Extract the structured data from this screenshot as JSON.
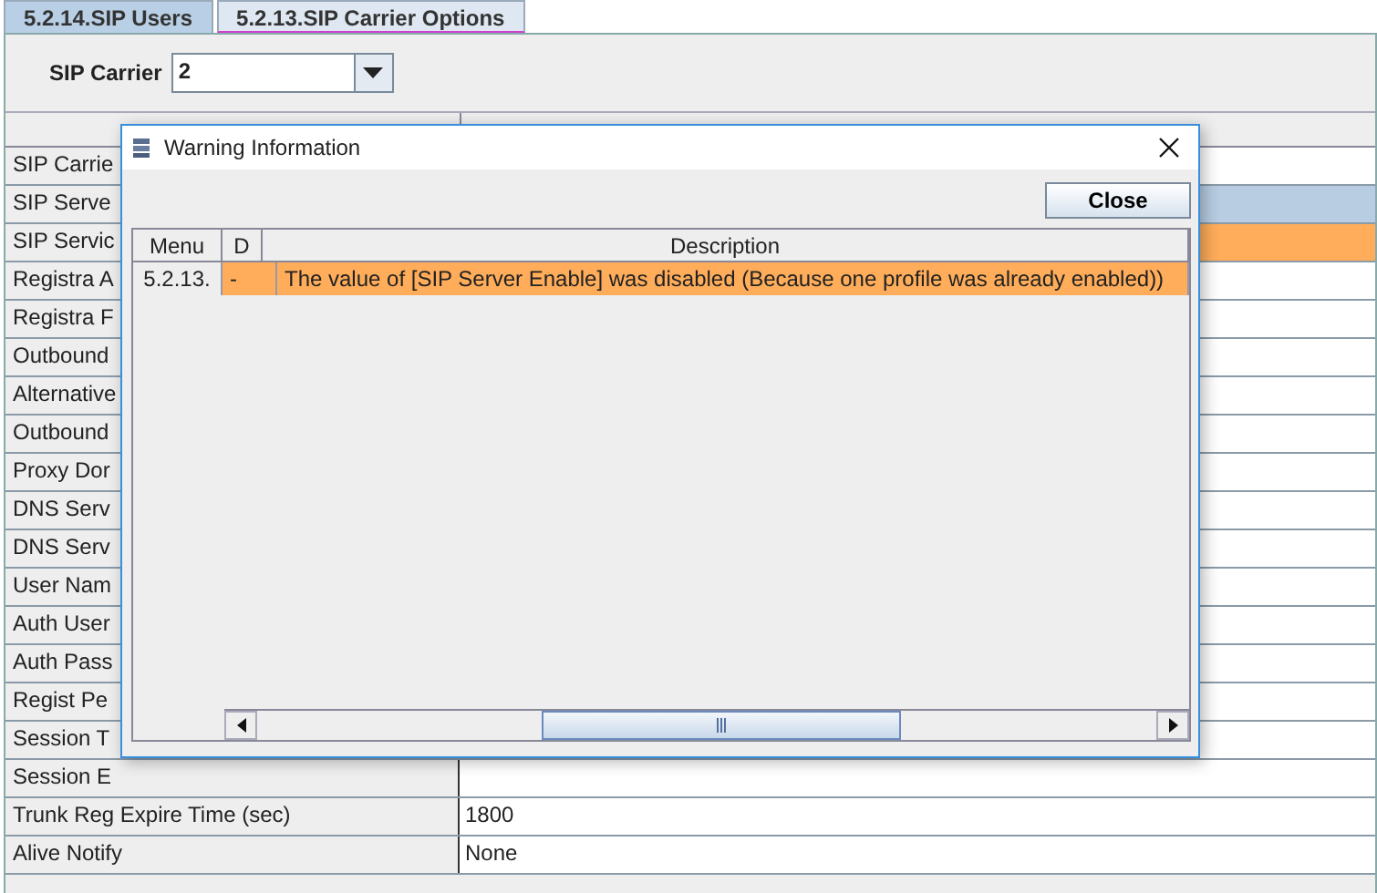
{
  "tabs": [
    {
      "label": "5.2.14.SIP Users",
      "selected": false
    },
    {
      "label": "5.2.13.SIP Carrier Options",
      "selected": true
    }
  ],
  "carrier": {
    "label": "SIP Carrier",
    "value": "2"
  },
  "table": {
    "rows": [
      {
        "label": "SIP Carrie",
        "value": "",
        "selected": false,
        "warning": false
      },
      {
        "label": "SIP Serve",
        "value": "",
        "selected": true,
        "warning": false
      },
      {
        "label": "SIP Servic",
        "value": "",
        "selected": false,
        "warning": true
      },
      {
        "label": "Registra A",
        "value": "",
        "selected": false,
        "warning": false
      },
      {
        "label": "Registra F",
        "value": "",
        "selected": false,
        "warning": false
      },
      {
        "label": "Outbound",
        "value": "",
        "selected": false,
        "warning": false
      },
      {
        "label": "Alternative",
        "value": "",
        "selected": false,
        "warning": false
      },
      {
        "label": "Outbound",
        "value": "",
        "selected": false,
        "warning": false
      },
      {
        "label": "Proxy Dor",
        "value": "",
        "selected": false,
        "warning": false
      },
      {
        "label": "DNS Serv",
        "value": "",
        "selected": false,
        "warning": false
      },
      {
        "label": "DNS Serv",
        "value": "",
        "selected": false,
        "warning": false
      },
      {
        "label": "User Nam",
        "value": "",
        "selected": false,
        "warning": false
      },
      {
        "label": "Auth User",
        "value": "",
        "selected": false,
        "warning": false
      },
      {
        "label": "Auth Pass",
        "value": "",
        "selected": false,
        "warning": false
      },
      {
        "label": "Regist Pe",
        "value": "",
        "selected": false,
        "warning": false
      },
      {
        "label": "Session T",
        "value": "",
        "selected": false,
        "warning": false
      },
      {
        "label": "Session E",
        "value": "",
        "selected": false,
        "warning": false
      },
      {
        "label": "Trunk Reg Expire Time (sec)",
        "value": "1800",
        "selected": false,
        "warning": false
      },
      {
        "label": "Alive Notify",
        "value": "None",
        "selected": false,
        "warning": false
      }
    ]
  },
  "dialog": {
    "title": "Warning Information",
    "close_button": "Close",
    "columns": [
      "Menu",
      "D",
      "Description"
    ],
    "rows": [
      {
        "cells": [
          "5.2.13.",
          "-",
          "The value of [SIP Server Enable] was disabled (Because one profile was already enabled))"
        ],
        "warning": true
      }
    ]
  }
}
